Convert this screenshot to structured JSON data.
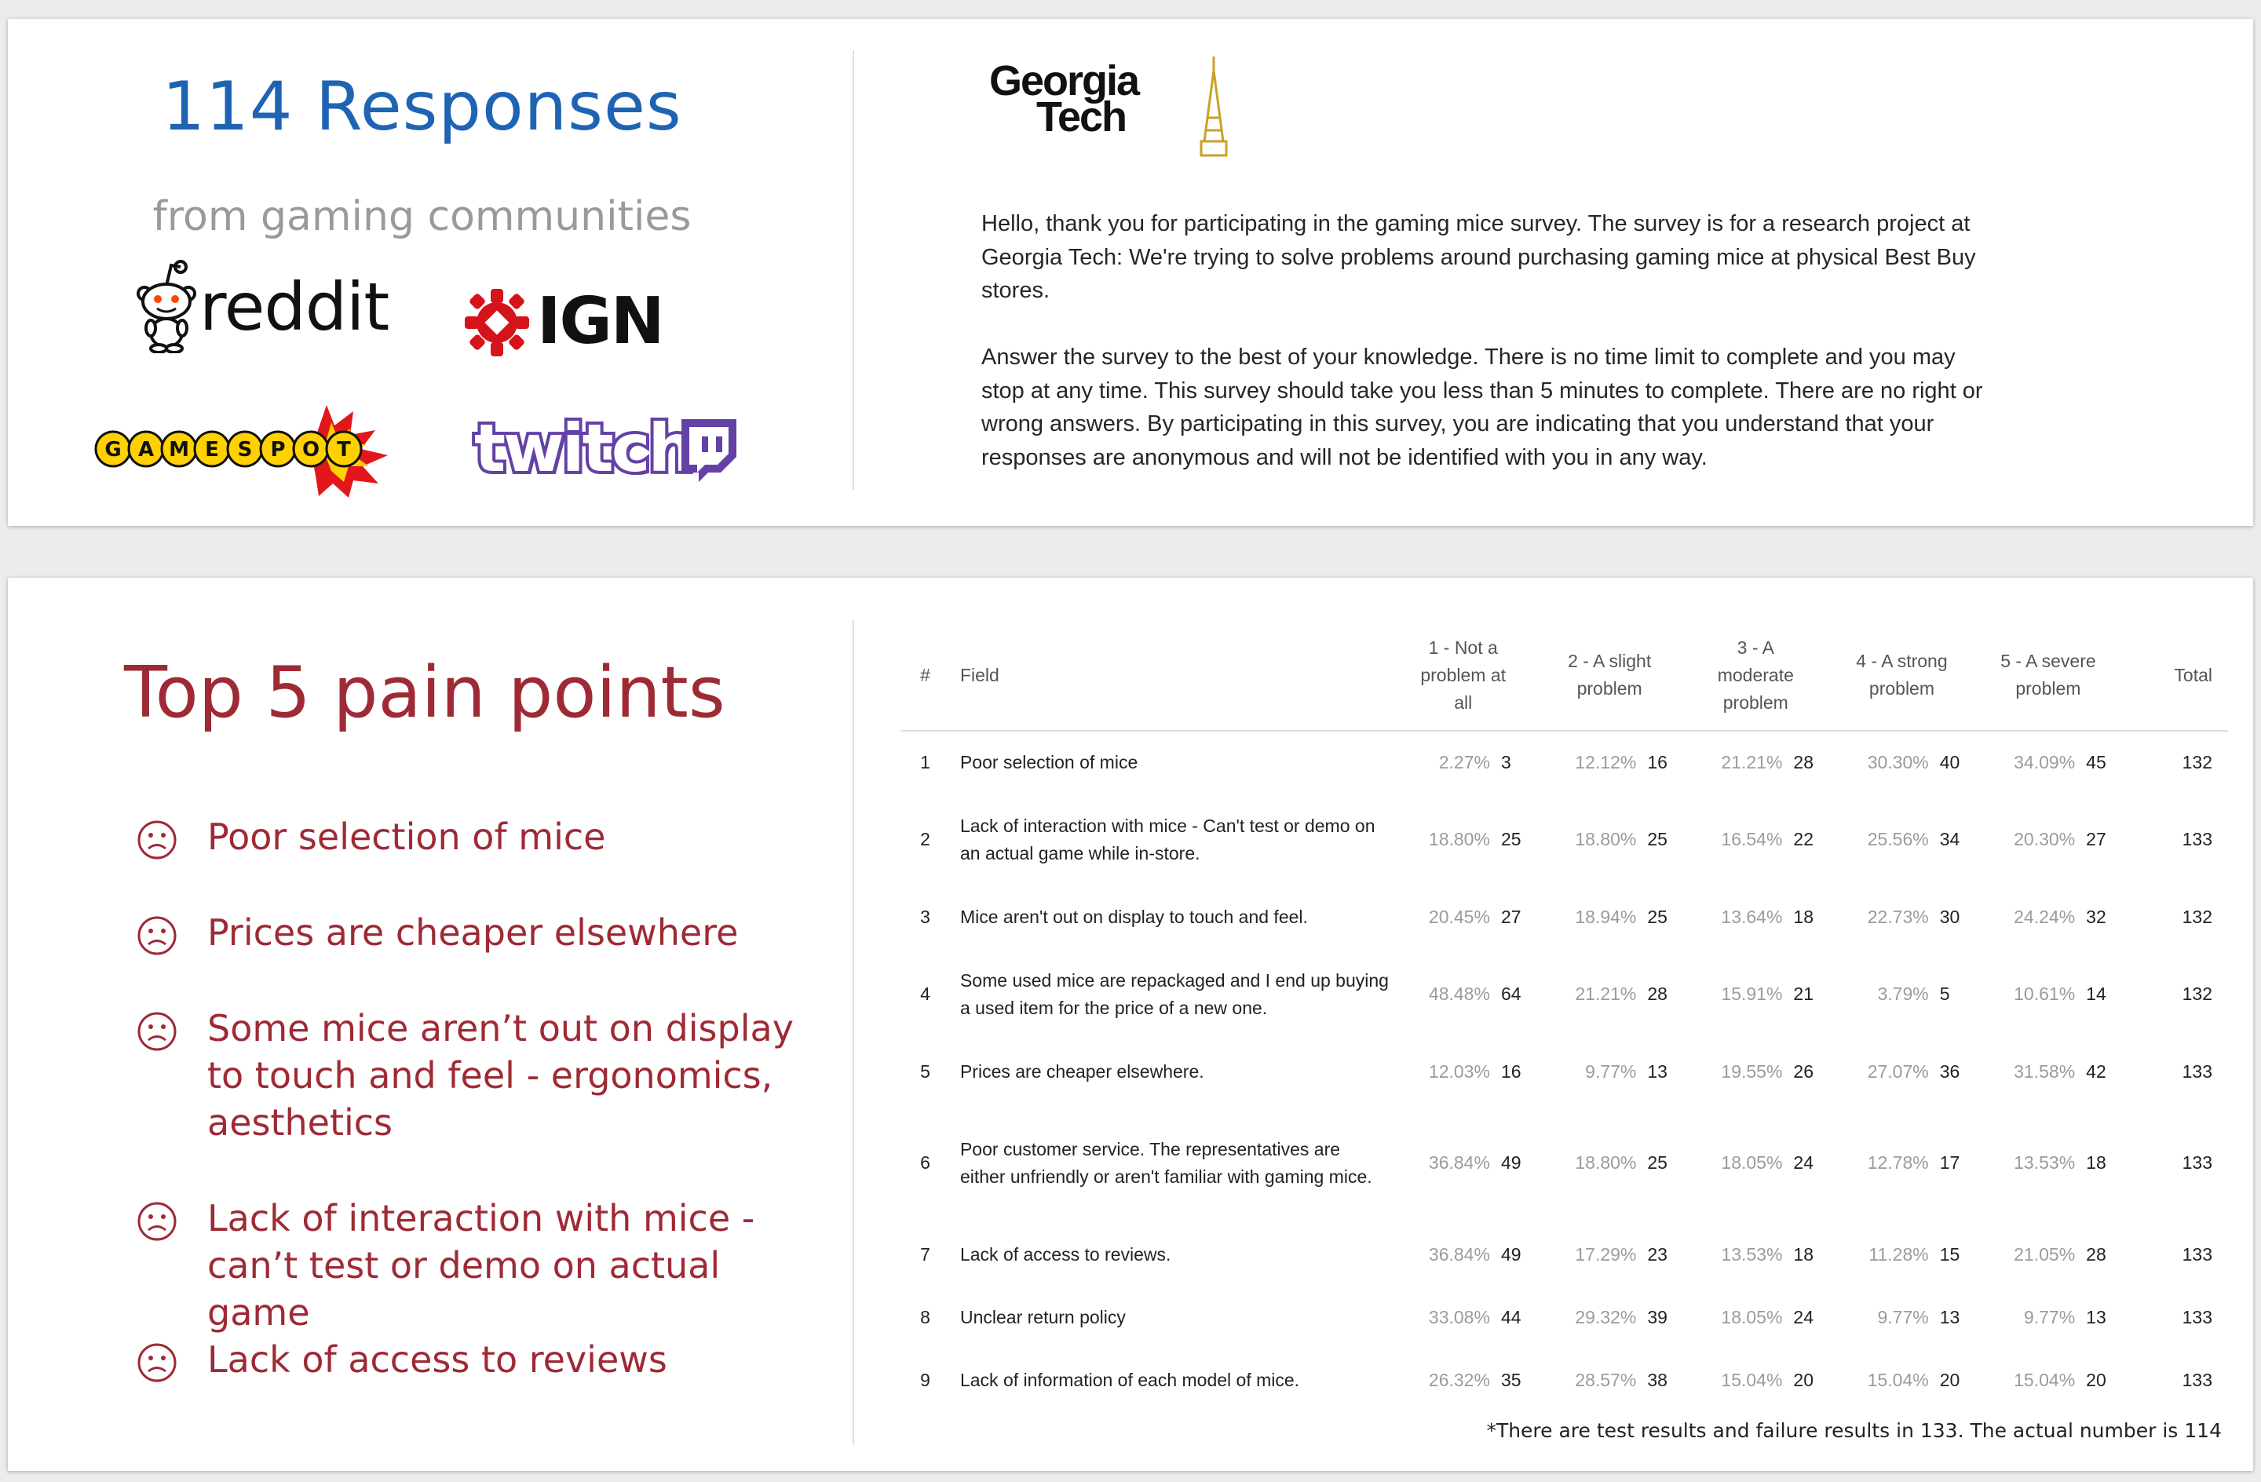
{
  "responses": {
    "title": "114 Responses",
    "subtitle": "from gaming communities",
    "logos": [
      {
        "name": "reddit",
        "text": "reddit"
      },
      {
        "name": "ign",
        "text": "IGN"
      },
      {
        "name": "gamespot",
        "text": "GAMESPOT"
      },
      {
        "name": "twitch",
        "text": "twitch"
      }
    ]
  },
  "intro": {
    "logo_line1": "Georgia",
    "logo_line2": "Tech",
    "paragraph1": "Hello, thank you for participating in the gaming mice survey. The survey is for a research project at Georgia Tech: We're trying to solve problems around purchasing gaming mice at physical Best Buy stores.",
    "paragraph2": "Answer the survey to the best of your knowledge. There is no time limit to complete and you may stop at any time. This survey should take you less than 5 minutes to complete. There are no right or wrong answers. By participating in this survey, you are indicating that you understand that your responses are anonymous and will not be identified with you in any way."
  },
  "pain_points": {
    "title": "Top 5 pain points",
    "items": [
      "Poor selection of mice",
      "Prices are cheaper elsewhere",
      "Some mice aren’t out on display to touch and feel - ergonomics, aesthetics",
      "Lack of interaction with mice - can’t test or demo on actual game",
      "Lack of access to reviews"
    ]
  },
  "table": {
    "headers": {
      "num": "#",
      "field": "Field",
      "c1": "1 - Not a problem at all",
      "c2": "2 - A slight problem",
      "c3": "3 - A moderate problem",
      "c4": "4 - A strong problem",
      "c5": "5 - A severe problem",
      "total": "Total"
    },
    "rows": [
      {
        "num": "1",
        "field": "Poor selection of mice",
        "p1": "2.27%",
        "n1": "3",
        "p2": "12.12%",
        "n2": "16",
        "p3": "21.21%",
        "n3": "28",
        "p4": "30.30%",
        "n4": "40",
        "p5": "34.09%",
        "n5": "45",
        "total": "132"
      },
      {
        "num": "2",
        "field": "Lack of interaction with mice - Can't test or demo on an actual game while in-store.",
        "p1": "18.80%",
        "n1": "25",
        "p2": "18.80%",
        "n2": "25",
        "p3": "16.54%",
        "n3": "22",
        "p4": "25.56%",
        "n4": "34",
        "p5": "20.30%",
        "n5": "27",
        "total": "133"
      },
      {
        "num": "3",
        "field": "Mice aren't out on display to touch and feel.",
        "p1": "20.45%",
        "n1": "27",
        "p2": "18.94%",
        "n2": "25",
        "p3": "13.64%",
        "n3": "18",
        "p4": "22.73%",
        "n4": "30",
        "p5": "24.24%",
        "n5": "32",
        "total": "132"
      },
      {
        "num": "4",
        "field": "Some used mice are repackaged and I end up buying a used item for the price of a new one.",
        "p1": "48.48%",
        "n1": "64",
        "p2": "21.21%",
        "n2": "28",
        "p3": "15.91%",
        "n3": "21",
        "p4": "3.79%",
        "n4": "5",
        "p5": "10.61%",
        "n5": "14",
        "total": "132"
      },
      {
        "num": "5",
        "field": "Prices are cheaper elsewhere.",
        "p1": "12.03%",
        "n1": "16",
        "p2": "9.77%",
        "n2": "13",
        "p3": "19.55%",
        "n3": "26",
        "p4": "27.07%",
        "n4": "36",
        "p5": "31.58%",
        "n5": "42",
        "total": "133"
      },
      {
        "num": "6",
        "field": "Poor customer service. The representatives are either unfriendly or aren't familiar with gaming mice.",
        "p1": "36.84%",
        "n1": "49",
        "p2": "18.80%",
        "n2": "25",
        "p3": "18.05%",
        "n3": "24",
        "p4": "12.78%",
        "n4": "17",
        "p5": "13.53%",
        "n5": "18",
        "total": "133"
      },
      {
        "num": "7",
        "field": "Lack of access to reviews.",
        "p1": "36.84%",
        "n1": "49",
        "p2": "17.29%",
        "n2": "23",
        "p3": "13.53%",
        "n3": "18",
        "p4": "11.28%",
        "n4": "15",
        "p5": "21.05%",
        "n5": "28",
        "total": "133"
      },
      {
        "num": "8",
        "field": "Unclear return policy",
        "p1": "33.08%",
        "n1": "44",
        "p2": "29.32%",
        "n2": "39",
        "p3": "18.05%",
        "n3": "24",
        "p4": "9.77%",
        "n4": "13",
        "p5": "9.77%",
        "n5": "13",
        "total": "133"
      },
      {
        "num": "9",
        "field": "Lack of information of each model of mice.",
        "p1": "26.32%",
        "n1": "35",
        "p2": "28.57%",
        "n2": "38",
        "p3": "15.04%",
        "n3": "20",
        "p4": "15.04%",
        "n4": "20",
        "p5": "15.04%",
        "n5": "20",
        "total": "133"
      }
    ],
    "footnote": "*There are test results and failure results in 133. The actual number is 114"
  },
  "colors": {
    "blue": "#1f63b4",
    "red": "#9e2a35",
    "gray": "#9a9a9a"
  }
}
